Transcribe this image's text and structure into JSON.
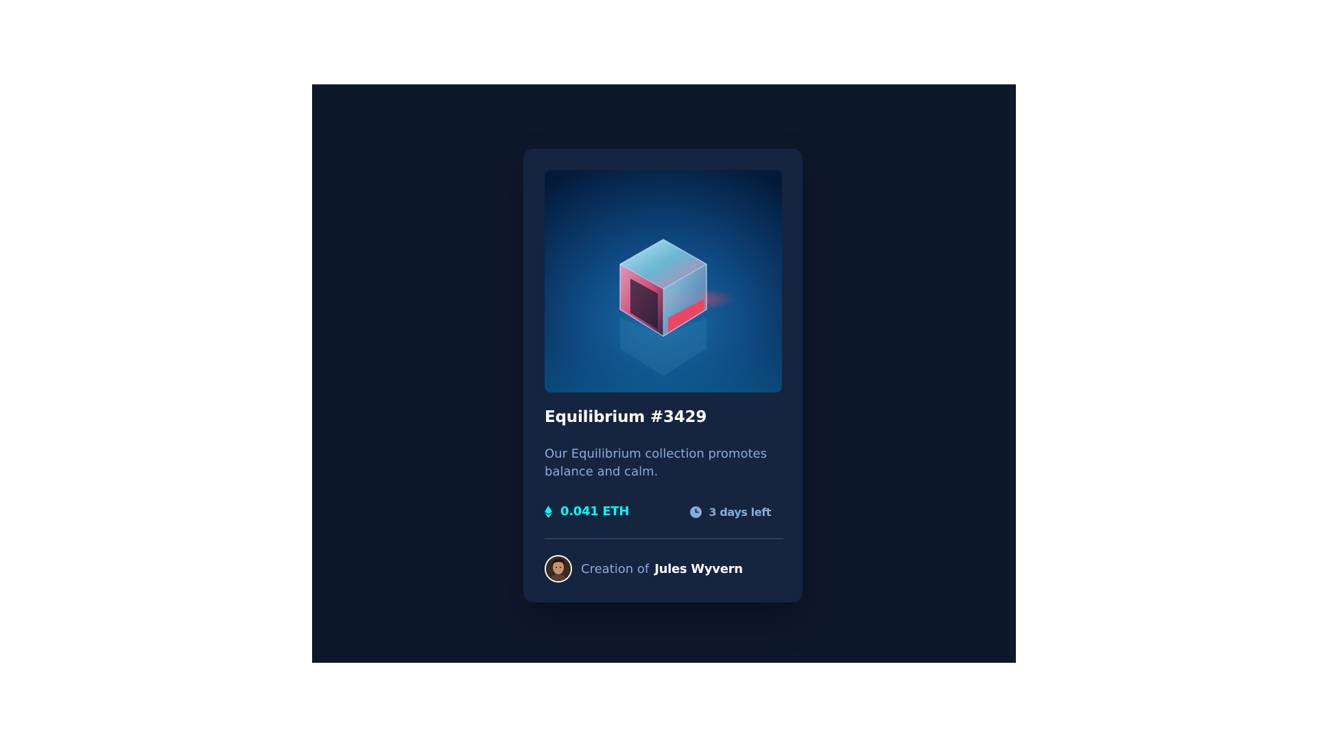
{
  "card": {
    "image_alt": "Equilibrium crystal cube",
    "title": "Equilibrium #3429",
    "description": "Our Equilibrium collection promotes balance and calm.",
    "price": "0.041 ETH",
    "price_icon": "ethereum-icon",
    "time_left": "3 days left",
    "time_icon": "clock-icon",
    "creator_label": "Creation of",
    "creator_name": "Jules Wyvern"
  },
  "colors": {
    "page_background": "#0e182b",
    "card_background": "#15243f",
    "accent_cyan": "#00fff8",
    "soft_blue": "#8bacd9",
    "white": "#ffffff"
  }
}
